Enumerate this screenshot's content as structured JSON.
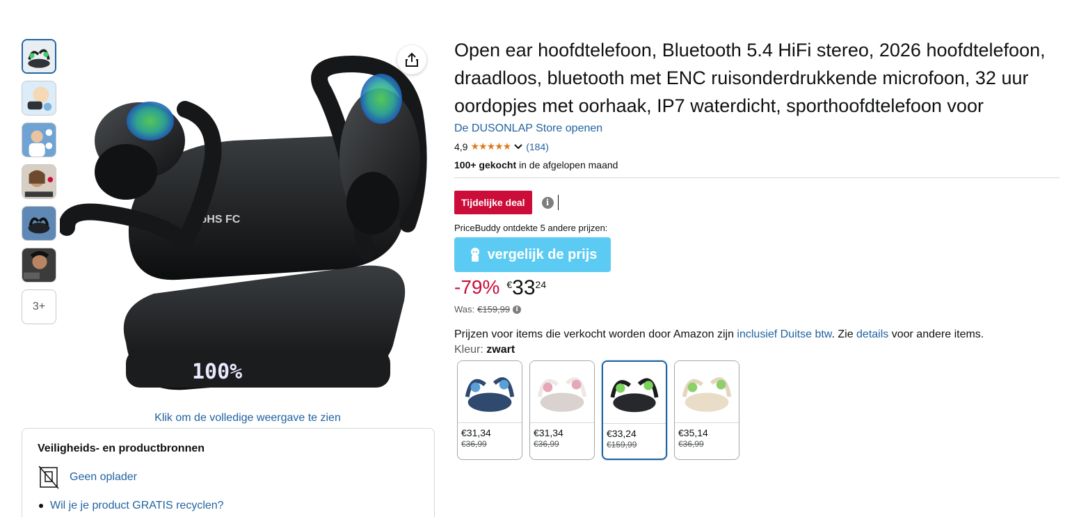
{
  "thumbnails": [
    {
      "name": "thumb-product-black",
      "tone": "#2f3338"
    },
    {
      "name": "thumb-ear-detail",
      "tone": "#9fc7e8"
    },
    {
      "name": "thumb-man-listening",
      "tone": "#6fa3d3"
    },
    {
      "name": "thumb-woman-wearing",
      "tone": "#b58f6d"
    },
    {
      "name": "thumb-charging-case",
      "tone": "#5f88b4"
    },
    {
      "name": "thumb-ipx-water",
      "tone": "#3b3b3b"
    }
  ],
  "thumb_more_label": "3+",
  "full_view_link": "Klik om de volledige weergave te zien",
  "safety": {
    "title": "Veiligheids- en productbronnen",
    "no_charger_label": "Geen oplader",
    "recycle_link": "Wil je je product GRATIS recyclen?"
  },
  "product": {
    "title": "Open ear hoofdtelefoon, Bluetooth 5.4 HiFi stereo, 2026 hoofdtelefoon, draadloos, bluetooth met ENC ruisonderdrukkende microfoon, 32 uur oordopjes met oorhaak, IP7 waterdicht, sporthoofdtelefoon voor",
    "store_link": "De DUSONLAP Store openen",
    "rating": "4,9",
    "stars": "★★★★★",
    "rating_count": "(184)",
    "bought_bold": "100+ gekocht",
    "bought_rest": " in de afgelopen maand"
  },
  "deal": {
    "badge": "Tijdelijke deal",
    "pricebuddy_text": "PriceBuddy ontdekte 5 andere prijzen:",
    "compare_button": "vergelijk de prijs"
  },
  "price": {
    "discount": "-79%",
    "currency": "€",
    "whole": "33",
    "fraction": "24",
    "was_label": "Was:",
    "was_value": "€159,99"
  },
  "vat": {
    "text_before": "Prijzen voor items die verkocht worden door Amazon zijn ",
    "link1": "inclusief Duitse btw",
    "text_mid": ". Zie ",
    "link2": "details",
    "text_after": " voor andere items."
  },
  "color": {
    "label": "Kleur: ",
    "value": "zwart"
  },
  "swatches": [
    {
      "price": "€31,34",
      "old": "€36,99",
      "tone": "#2f4a6e",
      "accent": "#5aa0d8"
    },
    {
      "price": "€31,34",
      "old": "€36,99",
      "tone": "#e6e1e0",
      "accent": "#e6a7b7"
    },
    {
      "price": "€33,24",
      "old": "€159,99",
      "tone": "#26282b",
      "accent": "#7ad35a"
    },
    {
      "price": "€35,14",
      "old": "€36,99",
      "tone": "#e9ddc8",
      "accent": "#8ccf6b"
    }
  ],
  "colors": {
    "link": "#2162a1",
    "deal_red": "#cc0c39",
    "compare_blue": "#5ccbf4",
    "star_orange": "#de7921"
  },
  "icons": [
    "share-icon",
    "info-icon",
    "chevron-down-icon",
    "no-charger-icon",
    "pricebuddy-icon"
  ]
}
